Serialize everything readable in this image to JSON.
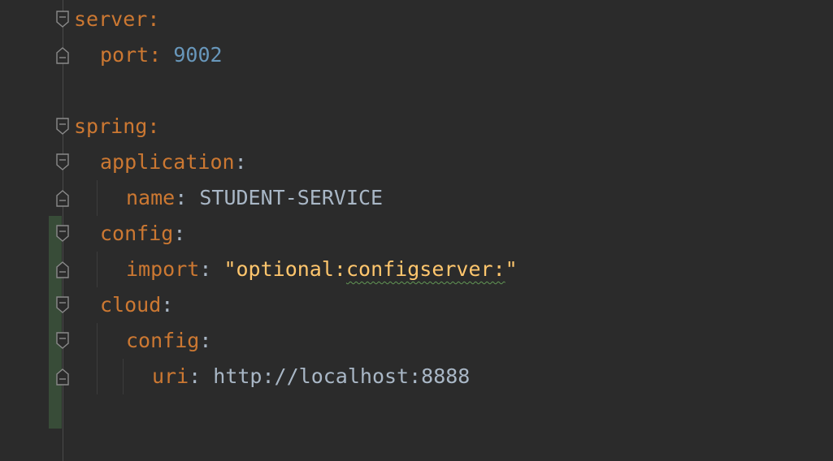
{
  "editor": {
    "language": "yaml",
    "lines": [
      {
        "key": "server",
        "value": ""
      },
      {
        "key": "port",
        "value": "9002"
      },
      {
        "key": "",
        "value": ""
      },
      {
        "key": "spring",
        "value": ""
      },
      {
        "key": "application",
        "value": ""
      },
      {
        "key": "name",
        "value": "STUDENT-SERVICE"
      },
      {
        "key": "config",
        "value": ""
      },
      {
        "key": "import",
        "value_open_quote": "\"",
        "value_part1": "optional:",
        "value_part2": "configserver:",
        "value_close_quote": "\""
      },
      {
        "key": "cloud",
        "value": ""
      },
      {
        "key": "config",
        "value": ""
      },
      {
        "key": "uri",
        "value": "http://localhost:8888"
      }
    ],
    "colon": ":",
    "colors": {
      "background": "#2b2b2b",
      "key": "#cc7832",
      "number": "#6897bb",
      "plain": "#a9b7c6",
      "string": "#ffc66d",
      "change_marker": "#384c38"
    },
    "fold_icons": [
      "fold-collapse-icon",
      "fold-end-icon"
    ]
  }
}
